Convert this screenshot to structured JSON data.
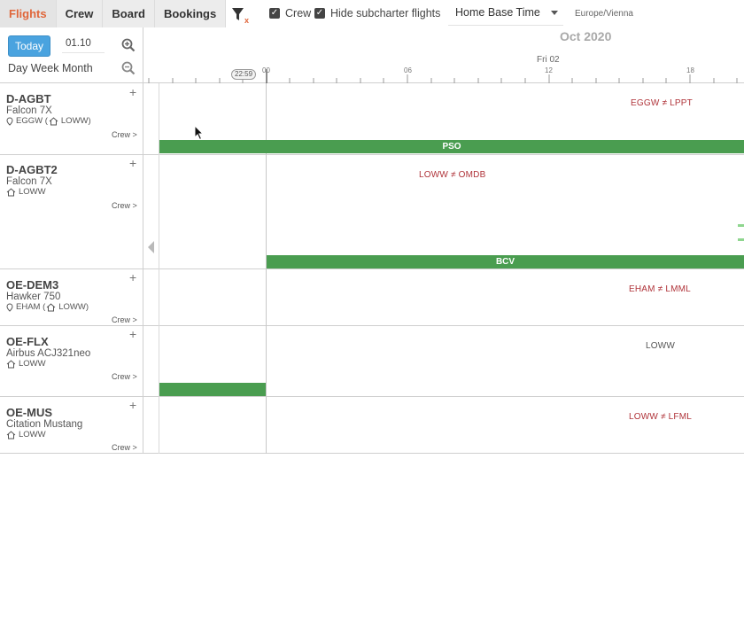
{
  "toolbar": {
    "tabs": [
      "Flights",
      "Crew",
      "Board",
      "Bookings"
    ],
    "crew_checkbox": "Crew",
    "hide_subcharter": "Hide subcharter flights",
    "timezone_mode": "Home Base Time",
    "timezone_name": "Europe/Vienna"
  },
  "controls": {
    "today": "Today",
    "date_value": "01.10",
    "day": "Day",
    "week": "Week",
    "month": "Month"
  },
  "timeline": {
    "month": "Oct 2020",
    "day": "Fri 02",
    "now": "22:59",
    "hours": [
      "00",
      "06",
      "12",
      "18"
    ]
  },
  "aircraft": [
    {
      "reg": "D-AGBT",
      "type": "Falcon 7X",
      "location": "EGGW (",
      "home_base": "LOWW)",
      "crew": "Crew >",
      "route": "EGGW ≠ LPPT",
      "bar_label": "PSO"
    },
    {
      "reg": "D-AGBT2",
      "type": "Falcon 7X",
      "home_base": "LOWW",
      "crew": "Crew >",
      "route": "LOWW ≠ OMDB",
      "bar_label": "BCV"
    },
    {
      "reg": "OE-DEM3",
      "type": "Hawker 750",
      "location": "EHAM (",
      "home_base": "LOWW)",
      "crew": "Crew >",
      "route": "EHAM ≠ LMML"
    },
    {
      "reg": "OE-FLX",
      "type": "Airbus ACJ321neo",
      "home_base": "LOWW",
      "crew": "Crew >",
      "route": "LOWW"
    },
    {
      "reg": "OE-MUS",
      "type": "Citation Mustang",
      "home_base": "LOWW",
      "crew": "Crew >",
      "route": "LOWW ≠ LFML"
    }
  ],
  "colors": {
    "active_tab": "#e0663a",
    "today_button": "#4aa3df",
    "bar_green": "#4a9d50",
    "route_red": "#b0343a"
  },
  "icons": [
    "filter-clear-icon",
    "checkbox-checked-icon",
    "zoom-in-icon",
    "zoom-out-icon",
    "location-pin-icon",
    "home-icon",
    "plus-icon",
    "collapse-arrow-icon",
    "mouse-cursor-icon"
  ]
}
